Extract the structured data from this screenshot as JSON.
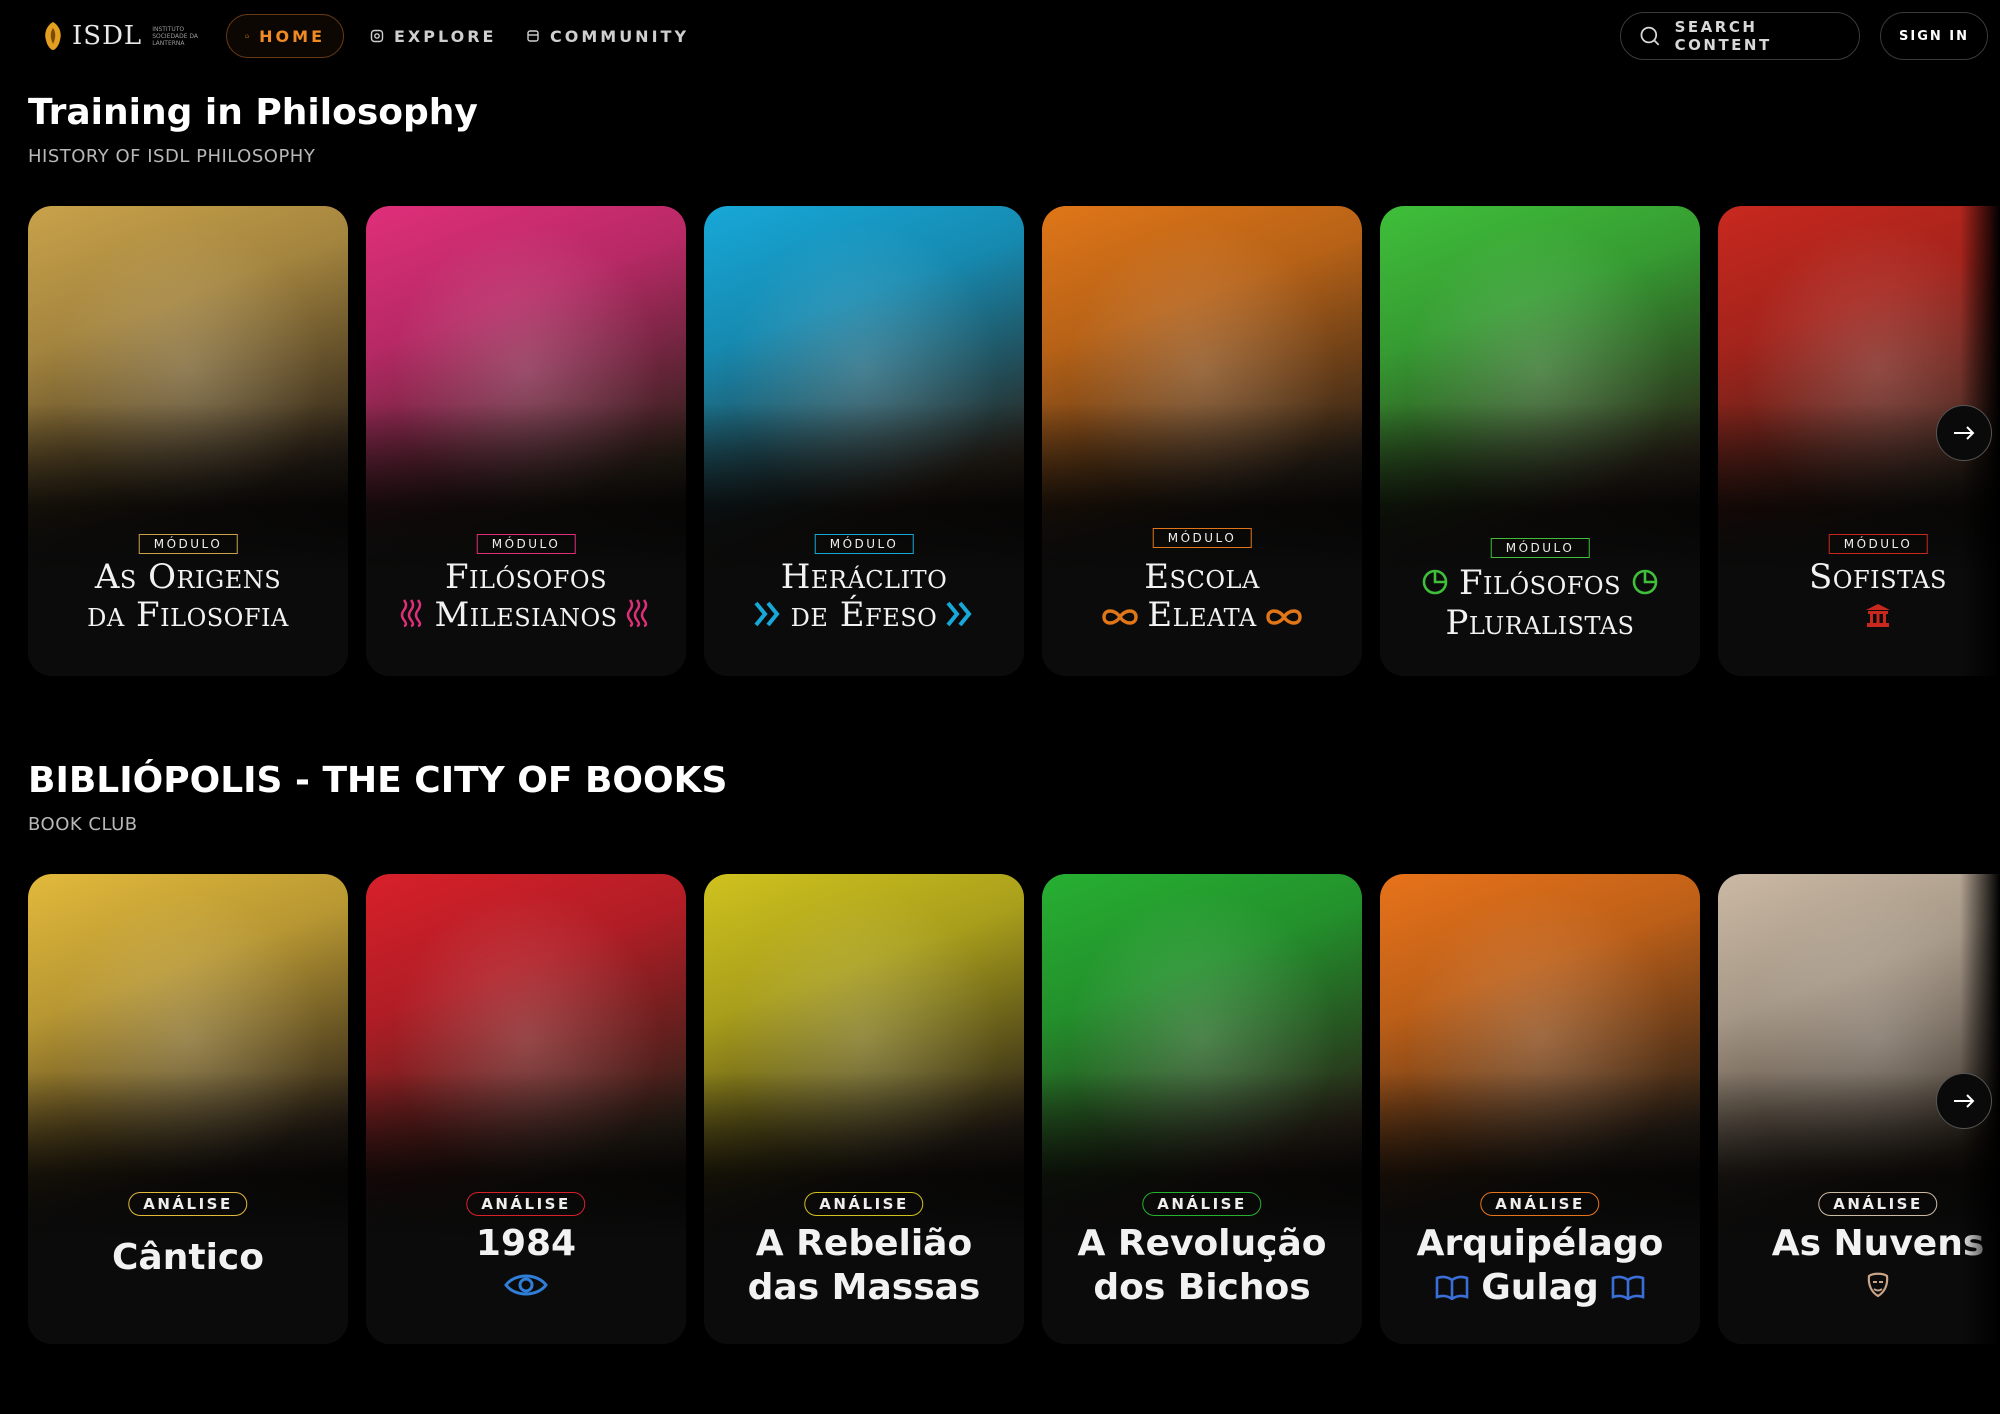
{
  "brand": {
    "name": "ISDL",
    "tagline": "INSTITUTO SOCIEDADE DA LANTERNA"
  },
  "nav": {
    "home": "HOME",
    "explore": "EXPLORE",
    "community": "COMMUNITY",
    "search": "SEARCH CONTENT",
    "signin": "SIGN IN"
  },
  "colors": {
    "accent": "#f08a24"
  },
  "sections": [
    {
      "title": "Training in Philosophy",
      "subtitle": "HISTORY OF ISDL PHILOSOPHY",
      "cards": [
        {
          "badge": "MÓDULO",
          "line1": "As Origens",
          "line2": "da Filosofia",
          "color": "#c9a24a",
          "icon": "none"
        },
        {
          "badge": "MÓDULO",
          "line1": "Filósofos",
          "line2": "Milesianos",
          "color": "#e02f7a",
          "icon": "water-waves-icon"
        },
        {
          "badge": "MÓDULO",
          "line1": "Heráclito",
          "line2": "de Éfeso",
          "color": "#17a8d8",
          "icon": "chevrons-icon"
        },
        {
          "badge": "MÓDULO",
          "line1": "Escola",
          "line2": "Eleata",
          "color": "#e07618",
          "icon": "infinity-icon"
        },
        {
          "badge": "MÓDULO",
          "line1": "Filósofos",
          "line2": "Pluralistas",
          "color": "#3fbf3a",
          "icon": "pie-icon"
        },
        {
          "badge": "MÓDULO",
          "line1": "Sofistas",
          "line2": "",
          "color": "#c8281e",
          "icon": "temple-icon"
        }
      ]
    },
    {
      "title": "BIBLIÓPOLIS - THE CITY OF BOOKS",
      "subtitle": "BOOK CLUB",
      "cards": [
        {
          "badge": "ANÁLISE",
          "line1": "Cântico",
          "line2": "",
          "color": "#e2b93b",
          "icon": "none"
        },
        {
          "badge": "ANÁLISE",
          "line1": "1984",
          "line2": "",
          "color": "#d8202a",
          "icon": "eye-icon"
        },
        {
          "badge": "ANÁLISE",
          "line1": "A Rebelião",
          "line2": "das Massas",
          "color": "#cfc21e",
          "icon": "none"
        },
        {
          "badge": "ANÁLISE",
          "line1": "A Revolução",
          "line2": "dos Bichos",
          "color": "#27b032",
          "icon": "none"
        },
        {
          "badge": "ANÁLISE",
          "line1": "Arquipélago",
          "line2": "Gulag",
          "color": "#e8731a",
          "icon": "book-icon"
        },
        {
          "badge": "ANÁLISE",
          "line1": "As Nuvens",
          "line2": "",
          "color": "#cbb9a4",
          "icon": "mask-icon"
        }
      ]
    }
  ]
}
